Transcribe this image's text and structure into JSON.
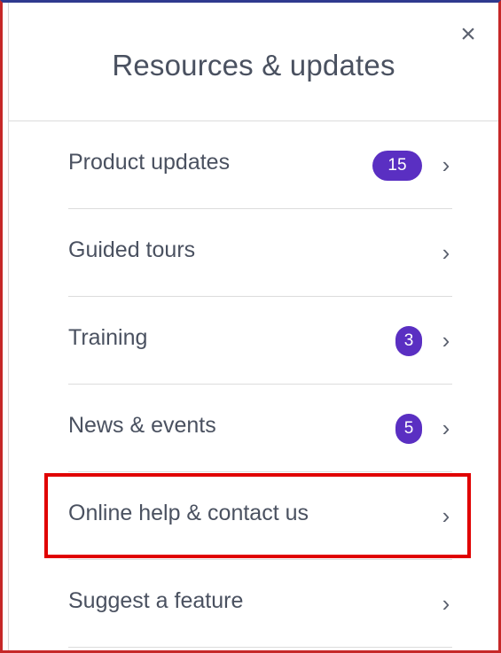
{
  "panel": {
    "title": "Resources & updates",
    "close_icon": "close-icon",
    "close_symbol": "×"
  },
  "menu": {
    "items": [
      {
        "label": "Product updates",
        "badge": "15",
        "chevron": "›"
      },
      {
        "label": "Guided tours",
        "badge": null,
        "chevron": "›"
      },
      {
        "label": "Training",
        "badge": "3",
        "chevron": "›"
      },
      {
        "label": "News & events",
        "badge": "5",
        "chevron": "›"
      },
      {
        "label": "Online help & contact us",
        "badge": null,
        "chevron": "›"
      },
      {
        "label": "Suggest a feature",
        "badge": null,
        "chevron": "›"
      }
    ]
  },
  "colors": {
    "badge": "#5a2fc2",
    "text": "#4a5160",
    "highlight": "#e00000"
  }
}
